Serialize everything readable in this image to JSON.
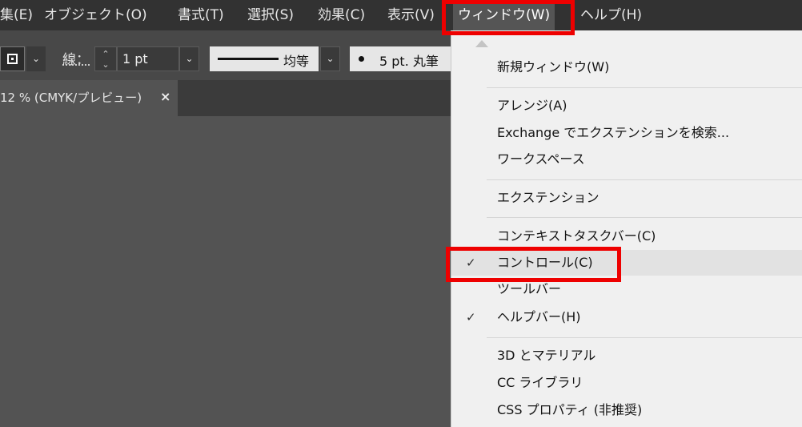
{
  "menubar": {
    "items": [
      "集(E)",
      "オブジェクト(O)",
      "書式(T)",
      "選択(S)",
      "効果(C)",
      "表示(V)",
      "ウィンドウ(W)",
      "ヘルプ(H)"
    ]
  },
  "toolbar": {
    "stroke_label": "線：",
    "stroke_weight": "1 pt",
    "profile_label": "均等",
    "brush_label": "5 pt. 丸筆"
  },
  "document_tab": {
    "title": "12 % (CMYK/プレビュー)",
    "close": "×"
  },
  "window_menu": {
    "items": [
      {
        "label": "新規ウィンドウ(W)",
        "checked": false
      },
      {
        "label": "アレンジ(A)",
        "checked": false
      },
      {
        "label": "Exchange でエクステンションを検索...",
        "checked": false
      },
      {
        "label": "ワークスペース",
        "checked": false
      },
      {
        "label": "エクステンション",
        "checked": false
      },
      {
        "label": "コンテキストタスクバー(C)",
        "checked": false
      },
      {
        "label": "コントロール(C)",
        "checked": true
      },
      {
        "label": "ツールバー",
        "checked": false
      },
      {
        "label": "ヘルプバー(H)",
        "checked": true
      },
      {
        "label": "3D とマテリアル",
        "checked": false
      },
      {
        "label": "CC ライブラリ",
        "checked": false
      },
      {
        "label": "CSS プロパティ (非推奨)",
        "checked": false
      }
    ],
    "check_glyph": "✓"
  },
  "colors": {
    "highlight": "#ee0000",
    "menubar_bg": "#323232",
    "dropdown_bg": "#f0f0f0"
  }
}
